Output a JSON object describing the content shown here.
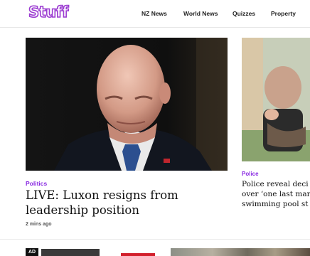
{
  "brand": {
    "logo_text": "Stuff",
    "color": "#9b3bd1"
  },
  "nav": {
    "items": [
      {
        "label": "NZ News"
      },
      {
        "label": "World News"
      },
      {
        "label": "Quizzes"
      },
      {
        "label": "Property"
      }
    ]
  },
  "lead": {
    "category": "Politics",
    "headline": "LIVE: Luxon resigns from leadership position",
    "time": "2 mins ago"
  },
  "second": {
    "category": "Police",
    "headline_lines": [
      "Police reveal deci",
      "over ‘one last mar",
      "swimming pool st"
    ]
  },
  "bottom": {
    "ad_label": "AD"
  },
  "colors": {
    "accent": "#8a2be2",
    "ad_red": "#d21f2b"
  }
}
